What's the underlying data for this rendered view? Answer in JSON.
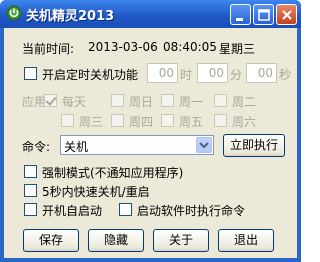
{
  "window": {
    "title": "关机精灵2013"
  },
  "clock": {
    "label": "当前时间:",
    "date": "2013-03-06",
    "time": "08:40:05",
    "weekday": "星期三"
  },
  "timer": {
    "enable_label": "开启定时关机功能",
    "hour_value": "00",
    "hour_unit": "时",
    "minute_value": "00",
    "minute_unit": "分",
    "second_value": "00",
    "second_unit": "秒"
  },
  "apply": {
    "label": "应用:",
    "days": [
      "每天",
      "周日",
      "周一",
      "周二",
      "周三",
      "周四",
      "周五",
      "周六"
    ],
    "everyday_checked": true
  },
  "command": {
    "label": "命令:",
    "selected": "关机",
    "execute_label": "立即执行"
  },
  "options": {
    "force_label": "强制模式(不通知应用程序)",
    "quick_label": "5秒内快速关机/重启",
    "autostart_label": "开机自启动",
    "run_on_start_label": "启动软件时执行命令"
  },
  "buttons": {
    "save": "保存",
    "hide": "隐藏",
    "about": "关于",
    "exit": "退出"
  },
  "colors": {
    "titlebar": "#2b67c9",
    "dialog_bg": "#ece9d8",
    "disabled_text": "#aca899"
  }
}
